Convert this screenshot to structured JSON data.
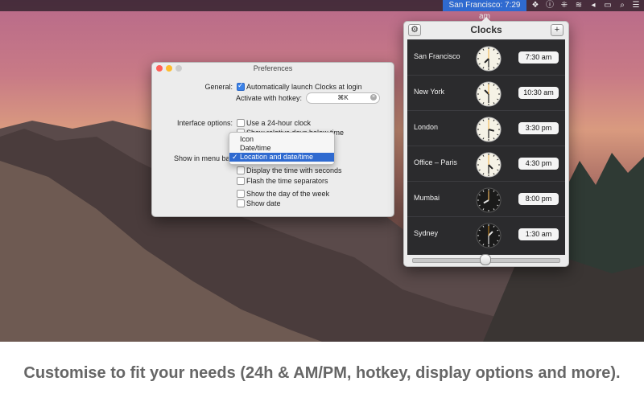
{
  "menubar": {
    "clock_label": "San Francisco: 7:29 am",
    "icons": [
      "dropbox-icon",
      "info-icon",
      "network-icon",
      "wifi-icon",
      "volume-icon",
      "display-icon",
      "search-icon",
      "list-icon"
    ]
  },
  "clocks": {
    "title": "Clocks",
    "gear_icon": "gear-icon",
    "add_icon": "plus-icon",
    "rows": [
      {
        "city": "San Francisco",
        "time": "7:30 am",
        "dark": false,
        "hour": 7,
        "minute": 30
      },
      {
        "city": "New York",
        "time": "10:30 am",
        "dark": false,
        "hour": 10,
        "minute": 30
      },
      {
        "city": "London",
        "time": "3:30 pm",
        "dark": false,
        "hour": 3,
        "minute": 30
      },
      {
        "city": "Office – Paris",
        "time": "4:30 pm",
        "dark": false,
        "hour": 4,
        "minute": 30
      },
      {
        "city": "Mumbai",
        "time": "8:00 pm",
        "dark": true,
        "hour": 8,
        "minute": 0
      },
      {
        "city": "Sydney",
        "time": "1:30 am",
        "dark": true,
        "hour": 1,
        "minute": 30
      }
    ],
    "slider_value": 0.5
  },
  "prefs": {
    "title": "Preferences",
    "general_label": "General:",
    "auto_launch": "Automatically launch Clocks at login",
    "auto_launch_checked": true,
    "hotkey_label": "Activate with hotkey:",
    "hotkey_value": "⌘K",
    "interface_label": "Interface options:",
    "use24": "Use a 24-hour clock",
    "relative_days": "Show relative days below time",
    "show_in_menubar_label": "Show in menu bar:",
    "menubar_options": [
      "Icon",
      "Date/time",
      "Location and date/time"
    ],
    "menubar_selected": "Location and date/time",
    "show_seconds": "Display the time with seconds",
    "flash_separators": "Flash the time separators",
    "show_day": "Show the day of the week",
    "show_date": "Show date"
  },
  "caption": "Customise to fit your needs (24h & AM/PM, hotkey, display options and more)."
}
